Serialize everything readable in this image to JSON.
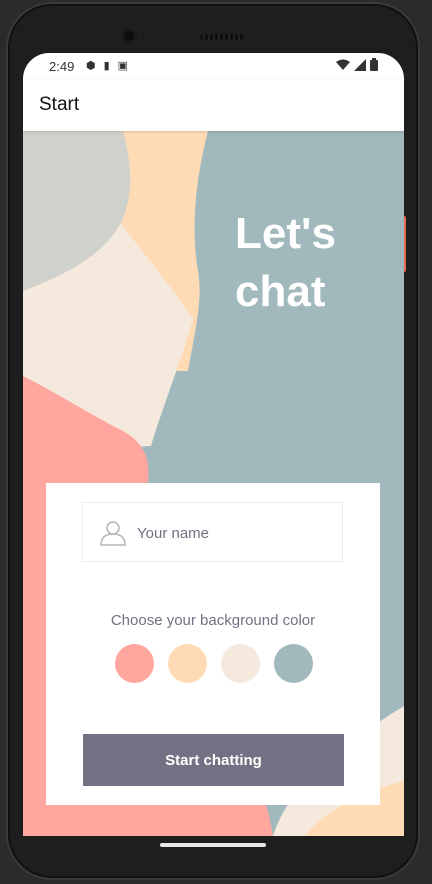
{
  "status_bar": {
    "time": "2:49",
    "left_icons": [
      "shield-icon",
      "sd-card-icon",
      "a-icon"
    ],
    "right_icons": [
      "wifi-icon",
      "signal-icon",
      "battery-icon"
    ]
  },
  "app_bar": {
    "title": "Start"
  },
  "hero": {
    "headline_line1": "Let's",
    "headline_line2": "chat"
  },
  "form": {
    "name_input": {
      "placeholder": "Your name",
      "value": ""
    },
    "choose_label": "Choose your background color",
    "colors": [
      "#FFA69E",
      "#FFDBB5",
      "#F5E9DE",
      "#A1B8BC"
    ],
    "start_button_label": "Start chatting"
  },
  "colors": {
    "button": "#757083",
    "text_muted": "#757083",
    "art_slate": "#A1B8BC",
    "art_peach": "#FFDBB5",
    "art_cream": "#F5E9DE",
    "art_salmon": "#FFA69E",
    "art_grey": "#CFD2CC"
  }
}
